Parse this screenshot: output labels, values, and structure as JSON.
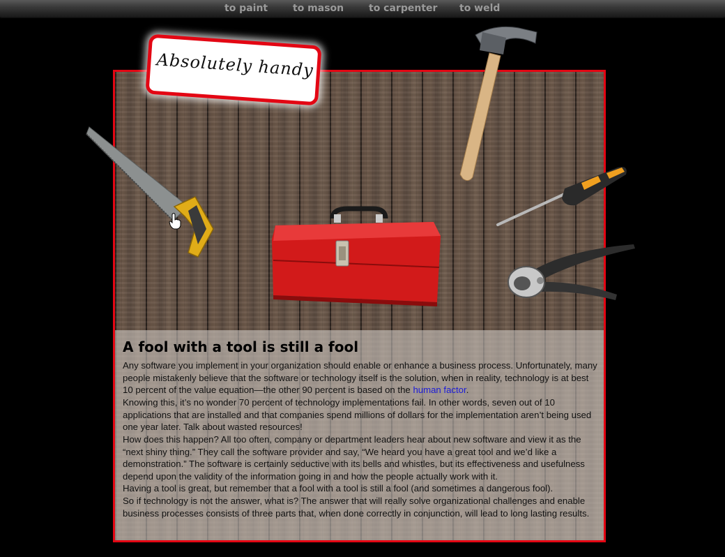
{
  "nav": {
    "items": [
      {
        "label": "to paint"
      },
      {
        "label": "to mason"
      },
      {
        "label": "to carpenter"
      },
      {
        "label": "to weld"
      }
    ]
  },
  "badge": {
    "text": "Absolutely handy"
  },
  "article": {
    "title": "A fool with a tool is still a fool",
    "p1_before": "Any software you implement in your organization should enable or enhance a business process. Unfortunately, many people mistakenly believe that the software or technology itself is the solution, when in reality, technology is at best 10 percent of the value equation—the other 90 percent is based on the ",
    "p1_link": "human factor",
    "p1_after": ".",
    "p2": "Knowing this, it’s no wonder 70 percent of technology implementations fail. In other words, seven out of 10 applications that are installed and that companies spend millions of dollars for the implementation aren’t being used one year later. Talk about wasted resources!",
    "p3": "How does this happen? All too often, company or department leaders hear about new software and view it as the “next shiny thing.” They call the software provider and say, “We heard you have a great tool and we’d like a demonstration.” The software is certainly seductive with its bells and whistles, but its effectiveness and usefulness depend upon the validity of the information going in and how the people actually work with it.",
    "p4": "Having a tool is great, but remember that a fool with a tool is still a fool (and sometimes a dangerous fool).",
    "p5": "So if technology is not the answer, what is? The answer that will really solve organizational challenges and enable business processes consists of three parts that, when done correctly in conjunction, will lead to long lasting results."
  },
  "tools": {
    "saw": "saw-icon",
    "hammer": "hammer-icon",
    "screwdriver": "screwdriver-icon",
    "pliers": "pincers-icon",
    "toolbox": "toolbox-icon"
  },
  "colors": {
    "accent": "#e30613",
    "link": "#1a1ad8",
    "nav_text": "#9a9a9a"
  }
}
